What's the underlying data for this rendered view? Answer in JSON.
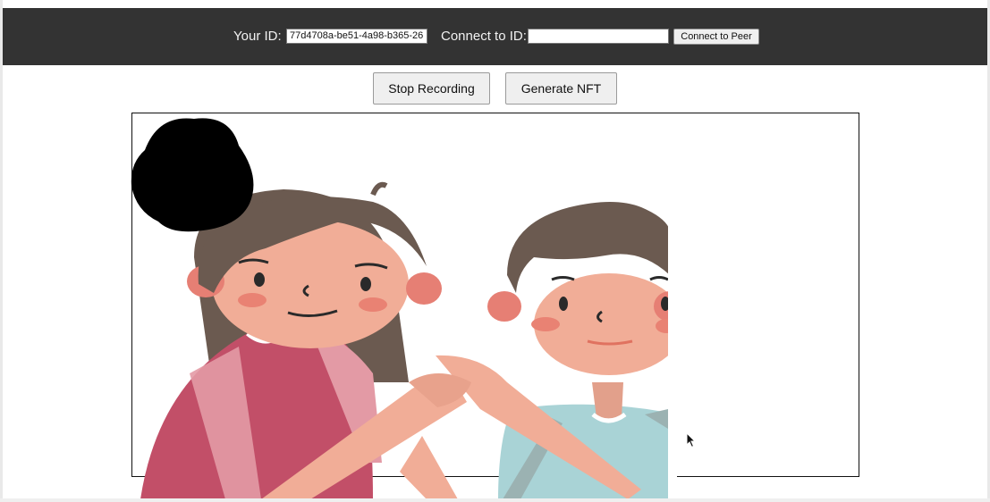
{
  "header": {
    "your_id_label": "Your ID:",
    "your_id_value": "77d4708a-be51-4a98-b365-26",
    "connect_label": "Connect to ID:",
    "connect_input_value": "",
    "connect_button": "Connect to Peer"
  },
  "controls": {
    "stop_recording": "Stop Recording",
    "generate_nft": "Generate NFT"
  },
  "colors": {
    "header_bg": "#333333",
    "girl_shirt": "#c24f68",
    "boy_shirt": "#a9d3d6",
    "skin": "#f1ad97",
    "hair": "#6b5a50"
  },
  "icons": [
    "mouse-cursor-icon"
  ]
}
